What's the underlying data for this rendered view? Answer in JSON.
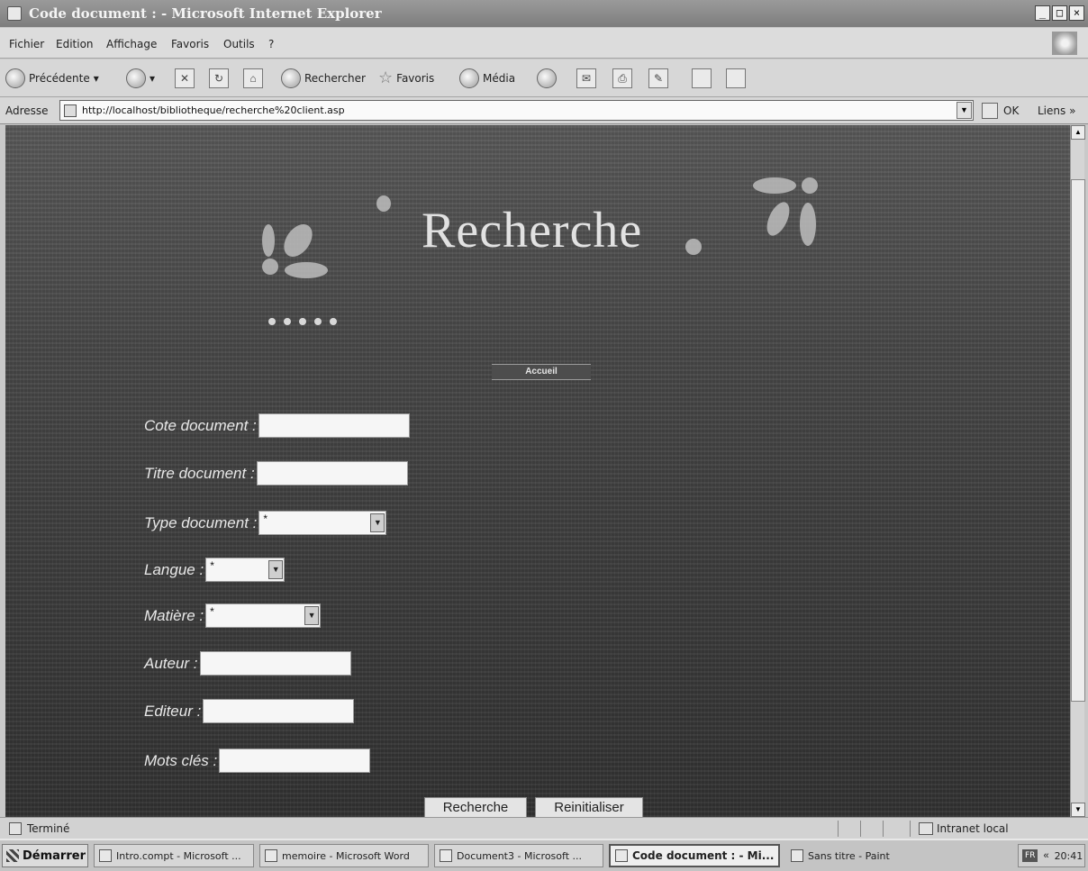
{
  "window": {
    "title": "Code document : - Microsoft Internet Explorer",
    "controls": {
      "minimize": "_",
      "maximize": "□",
      "close": "×"
    }
  },
  "menu": [
    "Fichier",
    "Edition",
    "Affichage",
    "Favoris",
    "Outils",
    "?"
  ],
  "toolbar": {
    "back": "Précédente",
    "search": "Rechercher",
    "favorites": "Favoris",
    "media": "Média"
  },
  "address": {
    "label": "Adresse",
    "url": "http://localhost/bibliotheque/recherche%20client.asp",
    "go_label": "OK",
    "links_label": "Liens »"
  },
  "page": {
    "heading": "Recherche",
    "nav_link": "Accueil",
    "form": {
      "cote_label": "Cote document :",
      "titre_label": "Titre document :",
      "type_label": "Type document :",
      "type_value": "*",
      "langue_label": "Langue :",
      "langue_value": "*",
      "matiere_label": "Matière :",
      "matiere_value": "*",
      "auteur_label": "Auteur :",
      "editeur_label": "Editeur :",
      "mots_label": "Mots clés :",
      "submit_label": "Recherche",
      "reset_label": "Reinitialiser"
    }
  },
  "status": {
    "text": "Terminé",
    "zone": "Intranet local"
  },
  "taskbar": {
    "start": "Démarrer",
    "tasks": [
      "Intro.compt - Microsoft ...",
      "memoire - Microsoft Word",
      "Document3 - Microsoft ...",
      "Code document : - Mi...",
      "Sans titre - Paint"
    ],
    "lang": "FR",
    "tray_arrow": "«",
    "clock": "20:41"
  }
}
